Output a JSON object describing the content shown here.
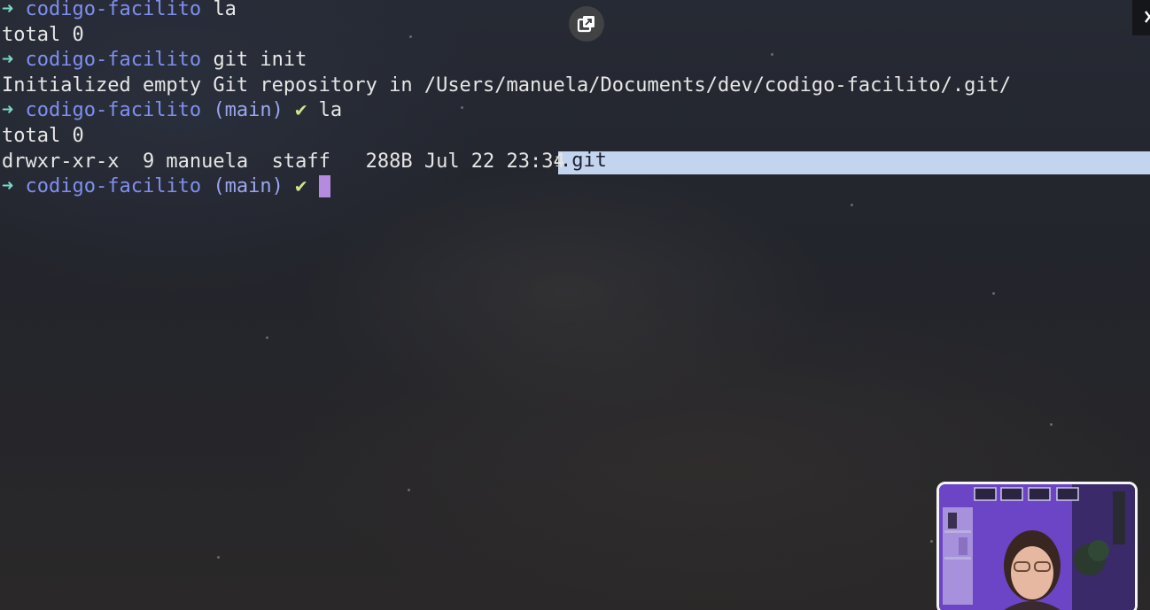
{
  "terminal": {
    "lines": [
      {
        "arrow": "➜",
        "dir": "codigo-facilito",
        "branch": "",
        "check": "",
        "cmd": "la"
      },
      {
        "output": "total 0"
      },
      {
        "arrow": "➜",
        "dir": "codigo-facilito",
        "branch": "",
        "check": "",
        "cmd": "git init"
      },
      {
        "output": "Initialized empty Git repository in /Users/manuela/Documents/dev/codigo-facilito/.git/"
      },
      {
        "arrow": "➜",
        "dir": "codigo-facilito",
        "branch": "(main)",
        "check": "✔",
        "cmd": "la"
      },
      {
        "output": "total 0"
      },
      {
        "output": "drwxr-xr-x  9 manuela  staff   288B Jul 22 23:34 "
      },
      {
        "arrow": "➜",
        "dir": "codigo-facilito",
        "branch": "(main)",
        "check": "✔",
        "cmd": ""
      }
    ],
    "selected_text": ".git",
    "ibeam_glyph": "I"
  },
  "icons": {
    "popout": "picture-in-picture-icon",
    "close": "close-icon"
  },
  "colors": {
    "prompt_arrow": "#7ad9c9",
    "directory": "#7f8ff0",
    "branch": "#9aa6ee",
    "check": "#cfe58a",
    "cursor": "#b58be0",
    "selection": "#c3d4ee"
  }
}
